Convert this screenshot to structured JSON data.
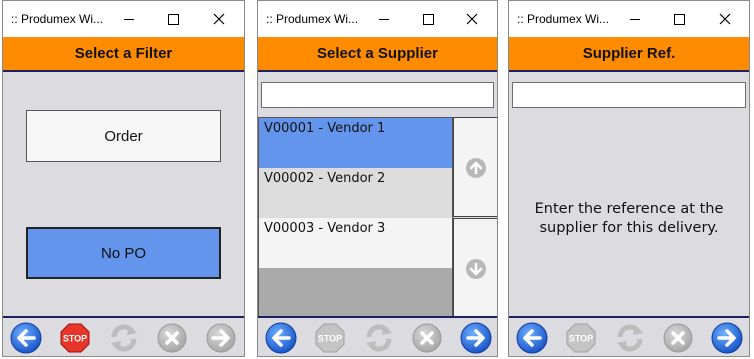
{
  "colors": {
    "header": "#ff8c00",
    "selected": "#6495ed",
    "accent": "#202060"
  },
  "windows": [
    {
      "title": ":: Produmex Wi...",
      "header": "Select a Filter",
      "filters": [
        {
          "label": "Order",
          "selected": false
        },
        {
          "label": "No PO",
          "selected": true
        }
      ],
      "toolbar": [
        "back-arrow-icon",
        "stop-icon",
        "refresh-icon",
        "cancel-icon",
        "forward-arrow-icon"
      ]
    },
    {
      "title": ":: Produmex Wi...",
      "header": "Select a Supplier",
      "search_value": "",
      "vendors": [
        {
          "label": "V00001 - Vendor 1",
          "selected": true
        },
        {
          "label": "V00002 - Vendor 2",
          "selected": false
        },
        {
          "label": "V00003 - Vendor 3",
          "selected": false
        }
      ],
      "toolbar": [
        "back-arrow-icon",
        "stop-icon",
        "refresh-icon",
        "cancel-icon",
        "forward-arrow-icon"
      ]
    },
    {
      "title": ":: Produmex Wi...",
      "header": "Supplier Ref.",
      "reference_value": "",
      "message": "Enter the reference at the supplier for this delivery.",
      "toolbar": [
        "back-arrow-icon",
        "stop-icon",
        "refresh-icon",
        "cancel-icon",
        "forward-arrow-icon"
      ]
    }
  ]
}
